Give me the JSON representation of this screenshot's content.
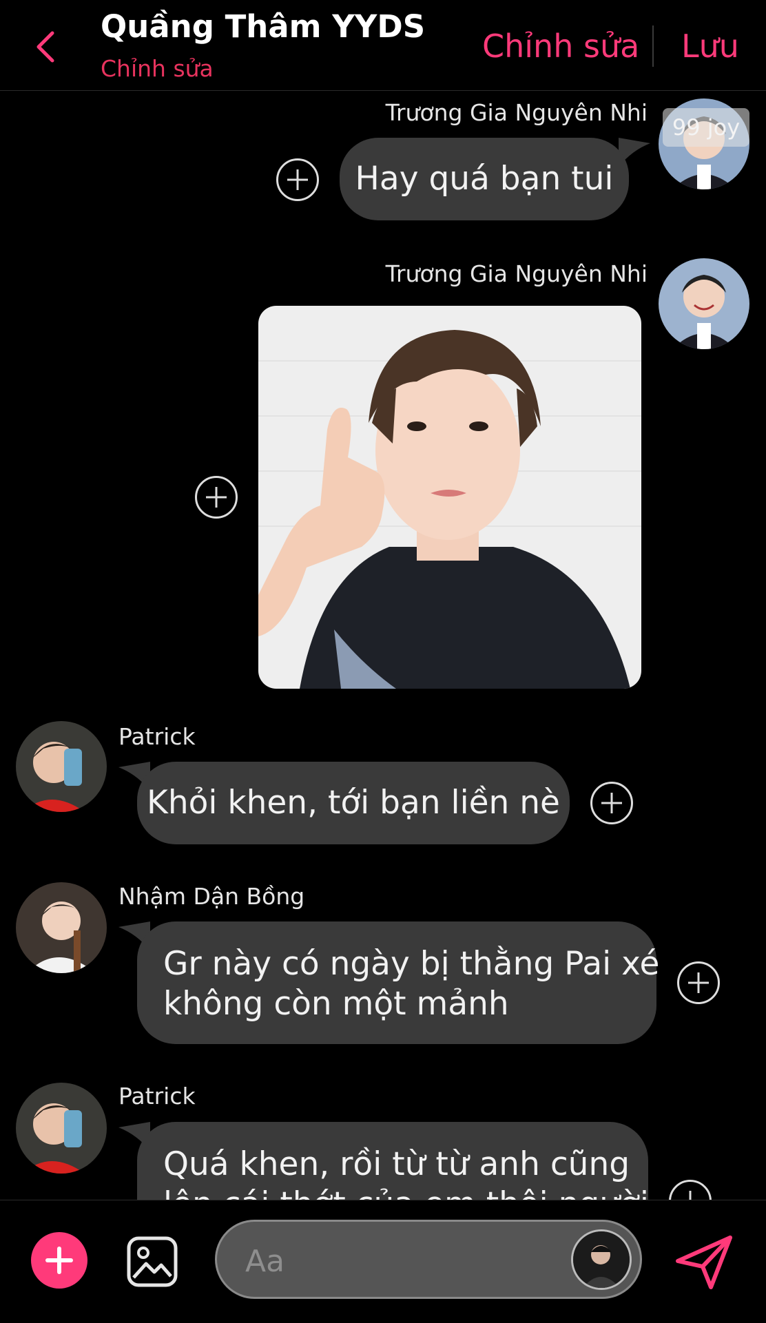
{
  "header": {
    "title": "Quầng Thâm YYDS",
    "subtitle": "Chỉnh sửa",
    "edit_label": "Chỉnh sửa",
    "save_label": "Lưu"
  },
  "messages": [
    {
      "sender": "Trương Gia Nguyên Nhi",
      "text": "Hay quá bạn tui",
      "side": "right",
      "badge": "99 joy"
    },
    {
      "sender": "Trương Gia Nguyên Nhi",
      "type": "image",
      "side": "right"
    },
    {
      "sender": "Patrick",
      "text": "Khỏi khen, tới bạn liền nè",
      "side": "left"
    },
    {
      "sender": "Nhậm Dận Bồng",
      "text_line1": "Gr này có ngày bị thằng Pai xé",
      "text_line2": "không còn một mảnh",
      "side": "left"
    },
    {
      "sender": "Patrick",
      "text_line1": "Quá khen, rồi từ từ anh cũng",
      "text_line2": "lên cái thớt của em thôi người",
      "side": "left"
    }
  ],
  "input": {
    "placeholder": "Aa"
  },
  "colors": {
    "accent": "#ff3a7a",
    "bubble": "#3a3a3a",
    "background": "#000000"
  },
  "icons": [
    "back-icon",
    "plus-icon",
    "image-icon",
    "send-icon"
  ]
}
